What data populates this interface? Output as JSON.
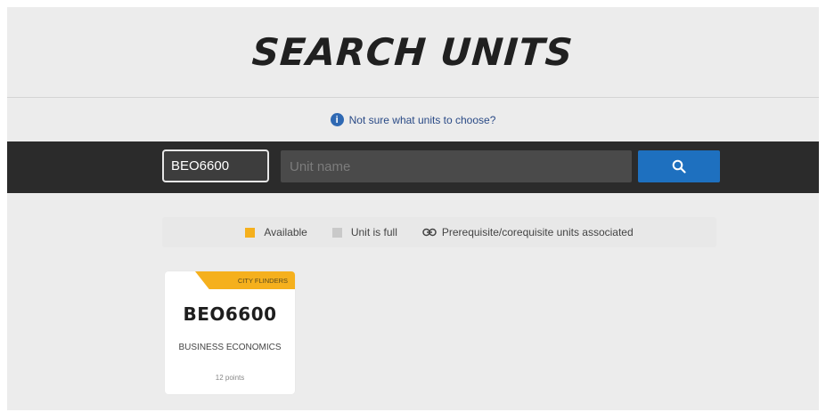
{
  "header": {
    "title": "SEARCH UNITS"
  },
  "help": {
    "icon": "info-icon",
    "label": "Not sure what units to choose?"
  },
  "search": {
    "code_value": "BEO6600",
    "name_value": "",
    "name_placeholder": "Unit name",
    "button_icon": "search-icon"
  },
  "legend": {
    "available_label": "Available",
    "full_label": "Unit is full",
    "prereq_label": "Prerequisite/corequisite units associated",
    "available_color": "#f5b01d",
    "full_color": "#c9c9c9"
  },
  "results": [
    {
      "campus": "CITY FLINDERS",
      "code": "BEO6600",
      "name": "BUSINESS ECONOMICS",
      "points": "12 points"
    }
  ],
  "colors": {
    "accent": "#1e70bf",
    "search_bar_bg": "#2b2b2b",
    "page_bg": "#ececec"
  }
}
